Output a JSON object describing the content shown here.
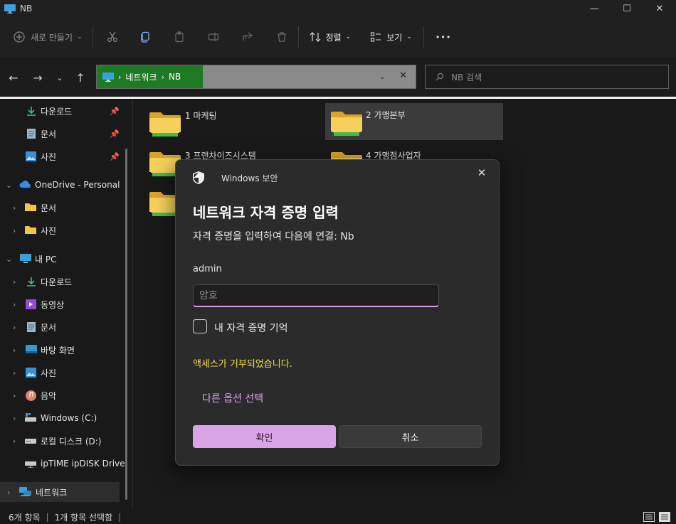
{
  "window": {
    "title": "NB",
    "minimize": "—",
    "maximize": "☐",
    "close": "✕"
  },
  "commandbar": {
    "new_label": "새로 만들기",
    "sort_label": "정렬",
    "view_label": "보기",
    "more": "•••"
  },
  "address": {
    "crumbs": [
      "네트워크",
      "NB"
    ],
    "search_placeholder": "NB 검색"
  },
  "sidebar": {
    "items": [
      {
        "label": "다운로드",
        "icon": "download-icon",
        "pinned": true
      },
      {
        "label": "문서",
        "icon": "document-icon",
        "pinned": true
      },
      {
        "label": "사진",
        "icon": "pictures-icon",
        "pinned": true
      },
      {
        "label": "OneDrive - Personal",
        "icon": "onedrive-icon"
      },
      {
        "label": "문서",
        "icon": "folder-icon"
      },
      {
        "label": "사진",
        "icon": "folder-icon"
      },
      {
        "label": "내 PC",
        "icon": "pc-icon"
      },
      {
        "label": "다운로드",
        "icon": "download-icon"
      },
      {
        "label": "동영상",
        "icon": "video-icon"
      },
      {
        "label": "문서",
        "icon": "document-icon"
      },
      {
        "label": "바탕 화면",
        "icon": "desktop-icon"
      },
      {
        "label": "사진",
        "icon": "pictures-icon"
      },
      {
        "label": "음악",
        "icon": "music-icon"
      },
      {
        "label": "Windows (C:)",
        "icon": "drive-icon"
      },
      {
        "label": "로컬 디스크 (D:)",
        "icon": "drive-icon"
      },
      {
        "label": "ipTIME ipDISK Drive",
        "icon": "network-drive-icon"
      },
      {
        "label": "네트워크",
        "icon": "network-icon"
      }
    ]
  },
  "folders": [
    {
      "name": "1 마케팅"
    },
    {
      "name": "2 가맹본부"
    },
    {
      "name": "3 프랜차이즈시스템"
    },
    {
      "name": "4 가맹점사업자"
    },
    {
      "name": ""
    }
  ],
  "status": {
    "count": "6개 항목",
    "selected": "1개 항목 선택함"
  },
  "dialog": {
    "caption": "Windows 보안",
    "title": "네트워크 자격 증명 입력",
    "subtitle": "자격 증명을 입력하여 다음에 연결: Nb",
    "username": "admin",
    "password_placeholder": "암호",
    "remember_label": "내 자격 증명 기억",
    "error": "액세스가 거부되었습니다.",
    "more_options": "다른 옵션 선택",
    "ok_label": "확인",
    "cancel_label": "취소"
  },
  "colors": {
    "accent": "#dba3e8",
    "error": "#f0e040",
    "address_highlight": "#1f7a24"
  }
}
